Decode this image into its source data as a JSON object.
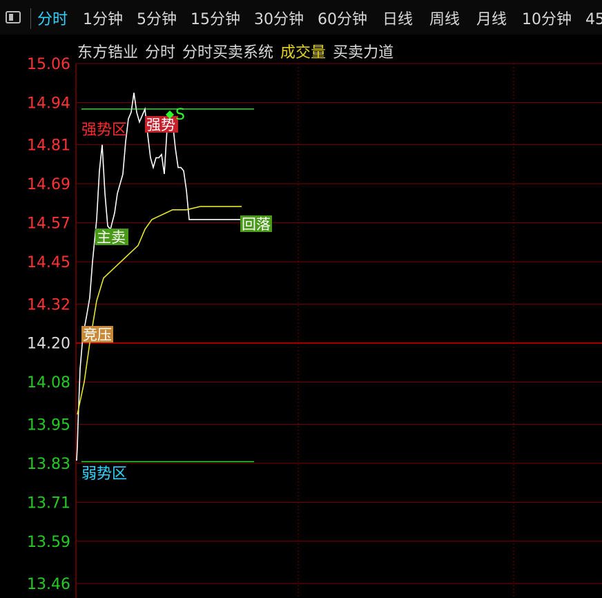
{
  "tabs": [
    {
      "label": "分时",
      "active": true
    },
    {
      "label": "1分钟",
      "active": false
    },
    {
      "label": "5分钟",
      "active": false
    },
    {
      "label": "15分钟",
      "active": false
    },
    {
      "label": "30分钟",
      "active": false
    },
    {
      "label": "60分钟",
      "active": false
    },
    {
      "label": "日线",
      "active": false
    },
    {
      "label": "周线",
      "active": false
    },
    {
      "label": "月线",
      "active": false
    },
    {
      "label": "10分钟",
      "active": false
    },
    {
      "label": "45",
      "active": false
    }
  ],
  "title_items": [
    {
      "text": "东方锆业",
      "color": "#d8d8d8"
    },
    {
      "text": "分时",
      "color": "#d8d8d8"
    },
    {
      "text": "分时买卖系统",
      "color": "#d8d8d8"
    },
    {
      "text": "成交量",
      "color": "#e6d21a"
    },
    {
      "text": "买卖力道",
      "color": "#d8d8d8"
    }
  ],
  "chart_data": {
    "type": "line",
    "prev_close": 14.2,
    "ylim": [
      13.46,
      15.06
    ],
    "y_ticks": [
      "15.06",
      "14.94",
      "14.81",
      "14.69",
      "14.57",
      "14.45",
      "14.32",
      "14.20",
      "14.08",
      "13.95",
      "13.83",
      "13.71",
      "13.59",
      "13.46"
    ],
    "series": [
      {
        "role": "price",
        "color": "#ffffff",
        "x": [
          0,
          1,
          2,
          3,
          6,
          10,
          16,
          20,
          24,
          30,
          34,
          38,
          42,
          46,
          50,
          56,
          60,
          64,
          68,
          72,
          76,
          80,
          84,
          88,
          92,
          96,
          100,
          104,
          108,
          112,
          116,
          120,
          124,
          128,
          132,
          136,
          140,
          144,
          148,
          152,
          156,
          160,
          164,
          168,
          172,
          176,
          180,
          186,
          192,
          196,
          200,
          204,
          208,
          212,
          216,
          220,
          224,
          228,
          232,
          236,
          240
        ],
        "y": [
          13.84,
          13.84,
          13.88,
          13.95,
          14.12,
          14.22,
          14.29,
          14.34,
          14.45,
          14.58,
          14.73,
          14.81,
          14.66,
          14.56,
          14.55,
          14.6,
          14.66,
          14.69,
          14.72,
          14.82,
          14.89,
          14.91,
          14.97,
          14.91,
          14.88,
          14.9,
          14.92,
          14.84,
          14.77,
          14.74,
          14.77,
          14.77,
          14.78,
          14.72,
          14.86,
          14.9,
          14.88,
          14.8,
          14.74,
          14.74,
          14.73,
          14.67,
          14.58,
          14.58,
          14.58,
          14.58,
          14.58,
          14.58,
          14.58,
          14.58,
          14.58,
          14.58,
          14.58,
          14.58,
          14.58,
          14.58,
          14.58,
          14.58,
          14.58,
          14.58,
          14.58
        ]
      },
      {
        "role": "average",
        "color": "#e6e62a",
        "x": [
          2,
          6,
          12,
          20,
          30,
          40,
          50,
          60,
          70,
          80,
          90,
          100,
          110,
          120,
          130,
          140,
          160,
          180,
          200,
          220,
          240
        ],
        "y": [
          13.98,
          14.02,
          14.08,
          14.2,
          14.33,
          14.4,
          14.42,
          14.44,
          14.46,
          14.48,
          14.5,
          14.55,
          14.58,
          14.59,
          14.6,
          14.61,
          14.61,
          14.62,
          14.62,
          14.62,
          14.62
        ]
      }
    ],
    "annotations": [
      {
        "text": "强势区",
        "color": "#ff2a2a"
      },
      {
        "text": "弱势区",
        "color": "#2fd4ff"
      },
      {
        "text": "强势",
        "bg": "#c8202a",
        "color": "#ffffff"
      },
      {
        "text": "主卖",
        "bg": "#4a9a1a",
        "color": "#ffffff"
      },
      {
        "text": "回落",
        "bg": "#4a9a1a",
        "color": "#ffffff"
      },
      {
        "text": "竞压",
        "bg": "#c88a3a",
        "color": "#ffffff"
      },
      {
        "text": "S",
        "color": "#2aff2a"
      }
    ],
    "zone_lines": [
      14.92,
      13.835
    ],
    "grid": true,
    "colors": {
      "up": "#ff3333",
      "down": "#22cc22",
      "grid": "#7a0000",
      "mid": "#b00000"
    }
  }
}
